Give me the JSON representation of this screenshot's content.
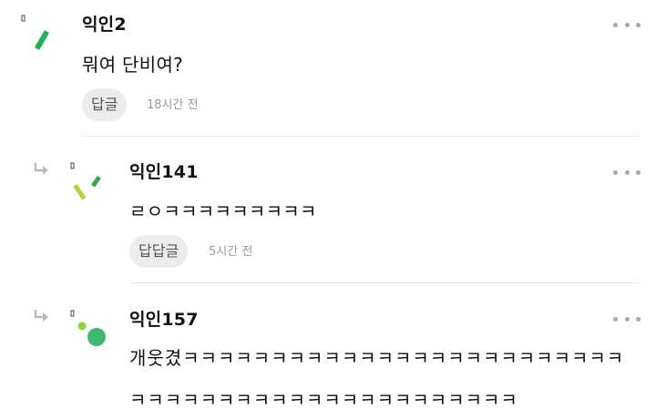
{
  "comments": [
    {
      "nickname": "익인2",
      "text": "뭐여 단비여?",
      "reply_label": "답글",
      "time": "18시간 전",
      "colors": [
        "#21b35a"
      ]
    },
    {
      "nickname": "익인141",
      "text": "ㄹㅇㅋㅋㅋㅋㅋㅋㅋㅋㅋ",
      "reply_label": "답답글",
      "time": "5시간 전",
      "colors": [
        "#b7d13a",
        "#33a851"
      ]
    },
    {
      "nickname": "익인157",
      "text": "개웃겼ㅋㅋㅋㅋㅋㅋㅋㅋㅋㅋㅋㅋㅋㅋㅋㅋㅋㅋㅋㅋㅋㅋㅋㅋㅋㅋㅋㅋㅋㅋㅋㅋㅋㅋㅋㅋㅋㅋㅋㅋㅋㅋㅋㅋㅋㅋㅋ",
      "colors": [
        "#8ed53a",
        "#3fb870"
      ]
    }
  ],
  "icons": {
    "more": "more-dots-icon",
    "reply": "reply-arrow-icon"
  }
}
